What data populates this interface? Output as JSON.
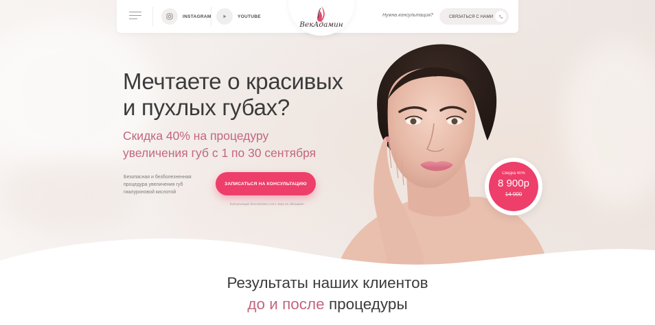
{
  "header": {
    "social": [
      {
        "label": "INSTAGRAM",
        "icon": "instagram-icon"
      },
      {
        "label": "YOUTUBE",
        "icon": "youtube-icon"
      }
    ],
    "logo_text": "ВекАдамин",
    "consult_question": "Нужна консультация?",
    "contact_button": "СВЯЗАТЬСЯ С НАМИ"
  },
  "hero": {
    "headline_line1": "Мечтаете о красивых",
    "headline_line2": "и пухлых губах?",
    "subhead_line1": "Скидка 40% на процедуру",
    "subhead_line2": "увеличения губ с 1 по 30 сентября",
    "desc_line1": "Безопасная и безболезненная",
    "desc_line2": "процедура увеличения губ",
    "desc_line3": "гиалуроновой кислотой",
    "cta_label": "ЗАПИСАТЬСЯ НА КОНСУЛЬТАЦИЮ",
    "cta_note": "Консультация бесплатная и ни к чему не обязывает"
  },
  "price_badge": {
    "discount": "Скидка 40%",
    "new_price": "8 900р",
    "old_price": "14 900"
  },
  "results": {
    "line1": "Результаты наших клиентов",
    "line2_pink": "до и после",
    "line2_rest": " процедуры"
  },
  "colors": {
    "accent": "#ee3e6a",
    "accent_text": "#c2667f",
    "text": "#3a3a3a"
  }
}
